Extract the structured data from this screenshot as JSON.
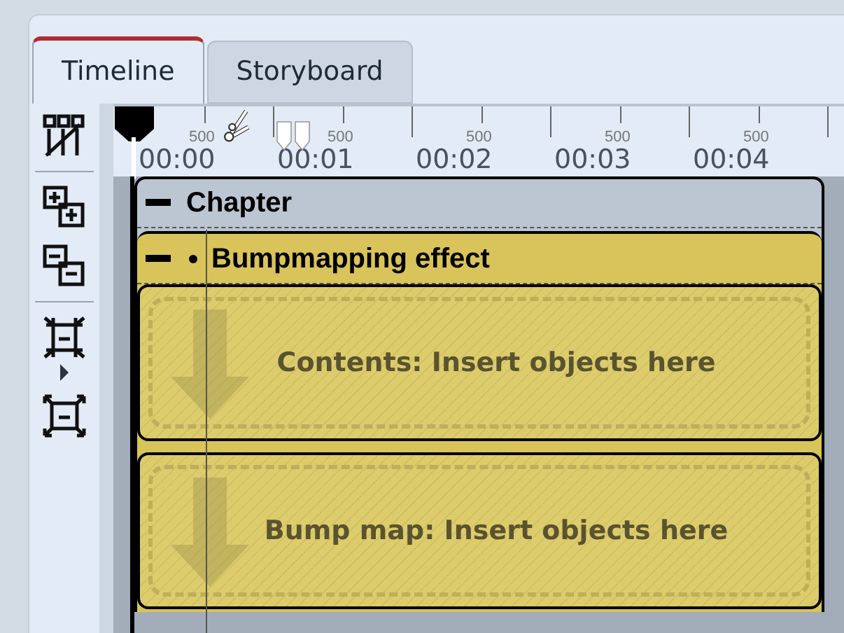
{
  "tabs": [
    {
      "label": "Timeline",
      "selected": true
    },
    {
      "label": "Storyboard",
      "selected": false
    }
  ],
  "ruler": {
    "time_labels": [
      "00:00",
      "00:01",
      "00:02",
      "00:03",
      "00:04"
    ],
    "half_labels": [
      "500",
      "500",
      "500",
      "500",
      "500"
    ]
  },
  "chapter": {
    "title": "Chapter",
    "expanded": true,
    "effect": {
      "title": "Bumpmapping effect",
      "expanded": true,
      "slots": [
        {
          "label": "Contents: Insert objects here"
        },
        {
          "label": "Bump map: Insert objects here"
        }
      ]
    }
  }
}
